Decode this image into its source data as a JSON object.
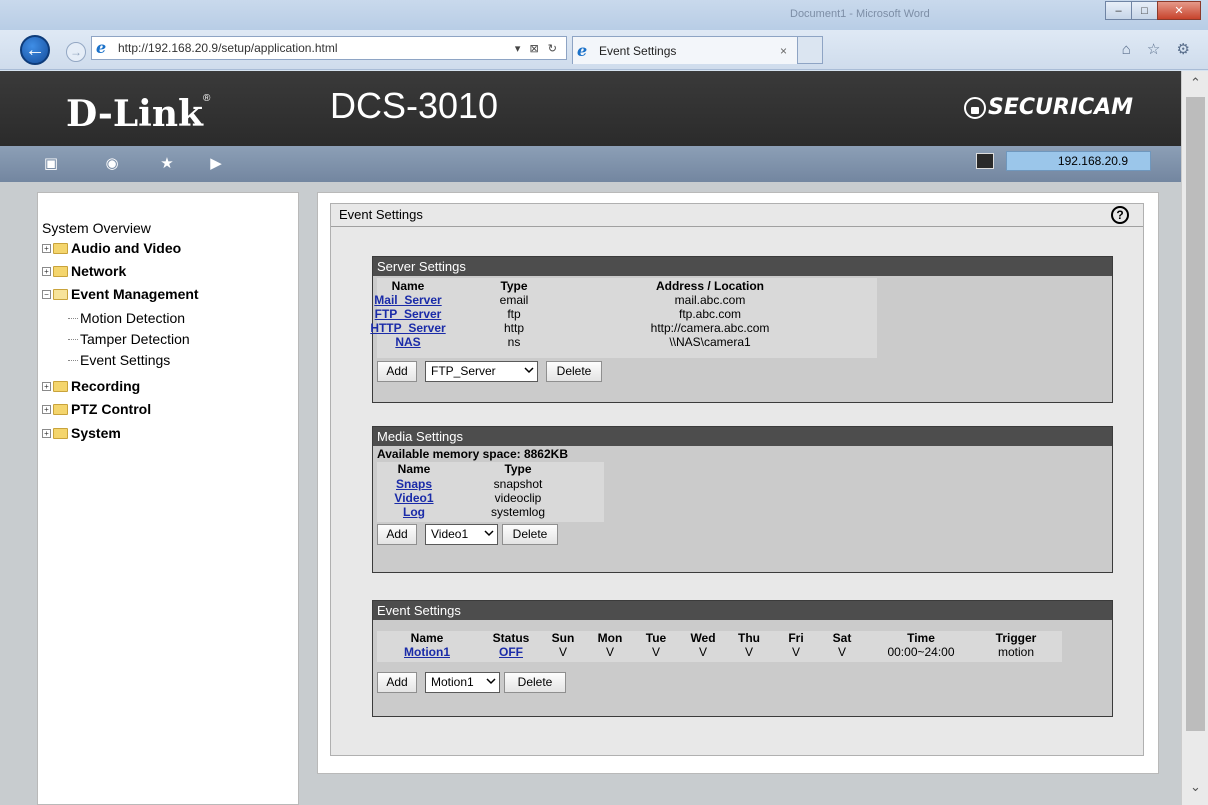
{
  "window": {
    "ghost_title": "Document1 - Microsoft Word",
    "minimize": "–",
    "maximize": "□",
    "close": "✕"
  },
  "browser": {
    "url": "http://192.168.20.9/setup/application.html",
    "addr_tools": "▾ ⊠ ↻",
    "tab_title": "Event Settings",
    "tab_close": "×",
    "tools": "⌂ ☆ ⚙",
    "back": "←",
    "forward": "→"
  },
  "header": {
    "brand": "D-Link",
    "brand_mark": "®",
    "model": "DCS-3010",
    "product": "SECURICAM"
  },
  "toolbar": {
    "ip": "192.168.20.9",
    "icons": [
      "live-video-icon",
      "setup-icon",
      "favorites-icon",
      "logout-icon"
    ]
  },
  "sidebar": {
    "overview": "System Overview",
    "items": [
      {
        "label": "Audio and Video",
        "expander": "+"
      },
      {
        "label": "Network",
        "expander": "+"
      },
      {
        "label": "Event Management",
        "expander": "−"
      },
      {
        "label": "Recording",
        "expander": "+"
      },
      {
        "label": "PTZ Control",
        "expander": "+"
      },
      {
        "label": "System",
        "expander": "+"
      }
    ],
    "sub_items": [
      "Motion Detection",
      "Tamper Detection",
      "Event Settings"
    ]
  },
  "main": {
    "title": "Event Settings",
    "help": "?"
  },
  "server_settings": {
    "title": "Server Settings",
    "headers": [
      "Name",
      "Type",
      "Address / Location"
    ],
    "rows": [
      {
        "name": "Mail_Server",
        "type": "email",
        "address": "mail.abc.com"
      },
      {
        "name": "FTP_Server",
        "type": "ftp",
        "address": "ftp.abc.com"
      },
      {
        "name": "HTTP_Server",
        "type": "http",
        "address": "http://camera.abc.com"
      },
      {
        "name": "NAS",
        "type": "ns",
        "address": "\\\\NAS\\camera1"
      }
    ],
    "add": "Add",
    "selected": "FTP_Server",
    "delete": "Delete"
  },
  "media_settings": {
    "title": "Media Settings",
    "available": "Available memory space: 8862KB",
    "headers": [
      "Name",
      "Type"
    ],
    "rows": [
      {
        "name": "Snaps",
        "type": "snapshot"
      },
      {
        "name": "Video1",
        "type": "videoclip"
      },
      {
        "name": "Log",
        "type": "systemlog"
      }
    ],
    "add": "Add",
    "selected": "Video1",
    "delete": "Delete"
  },
  "event_settings": {
    "title": "Event Settings",
    "headers": [
      "Name",
      "Status",
      "Sun",
      "Mon",
      "Tue",
      "Wed",
      "Thu",
      "Fri",
      "Sat",
      "Time",
      "Trigger"
    ],
    "row": {
      "name": "Motion1",
      "status": "OFF",
      "sun": "V",
      "mon": "V",
      "tue": "V",
      "wed": "V",
      "thu": "V",
      "fri": "V",
      "sat": "V",
      "time": "00:00~24:00",
      "trigger": "motion"
    },
    "add": "Add",
    "selected": "Motion1",
    "delete": "Delete"
  }
}
